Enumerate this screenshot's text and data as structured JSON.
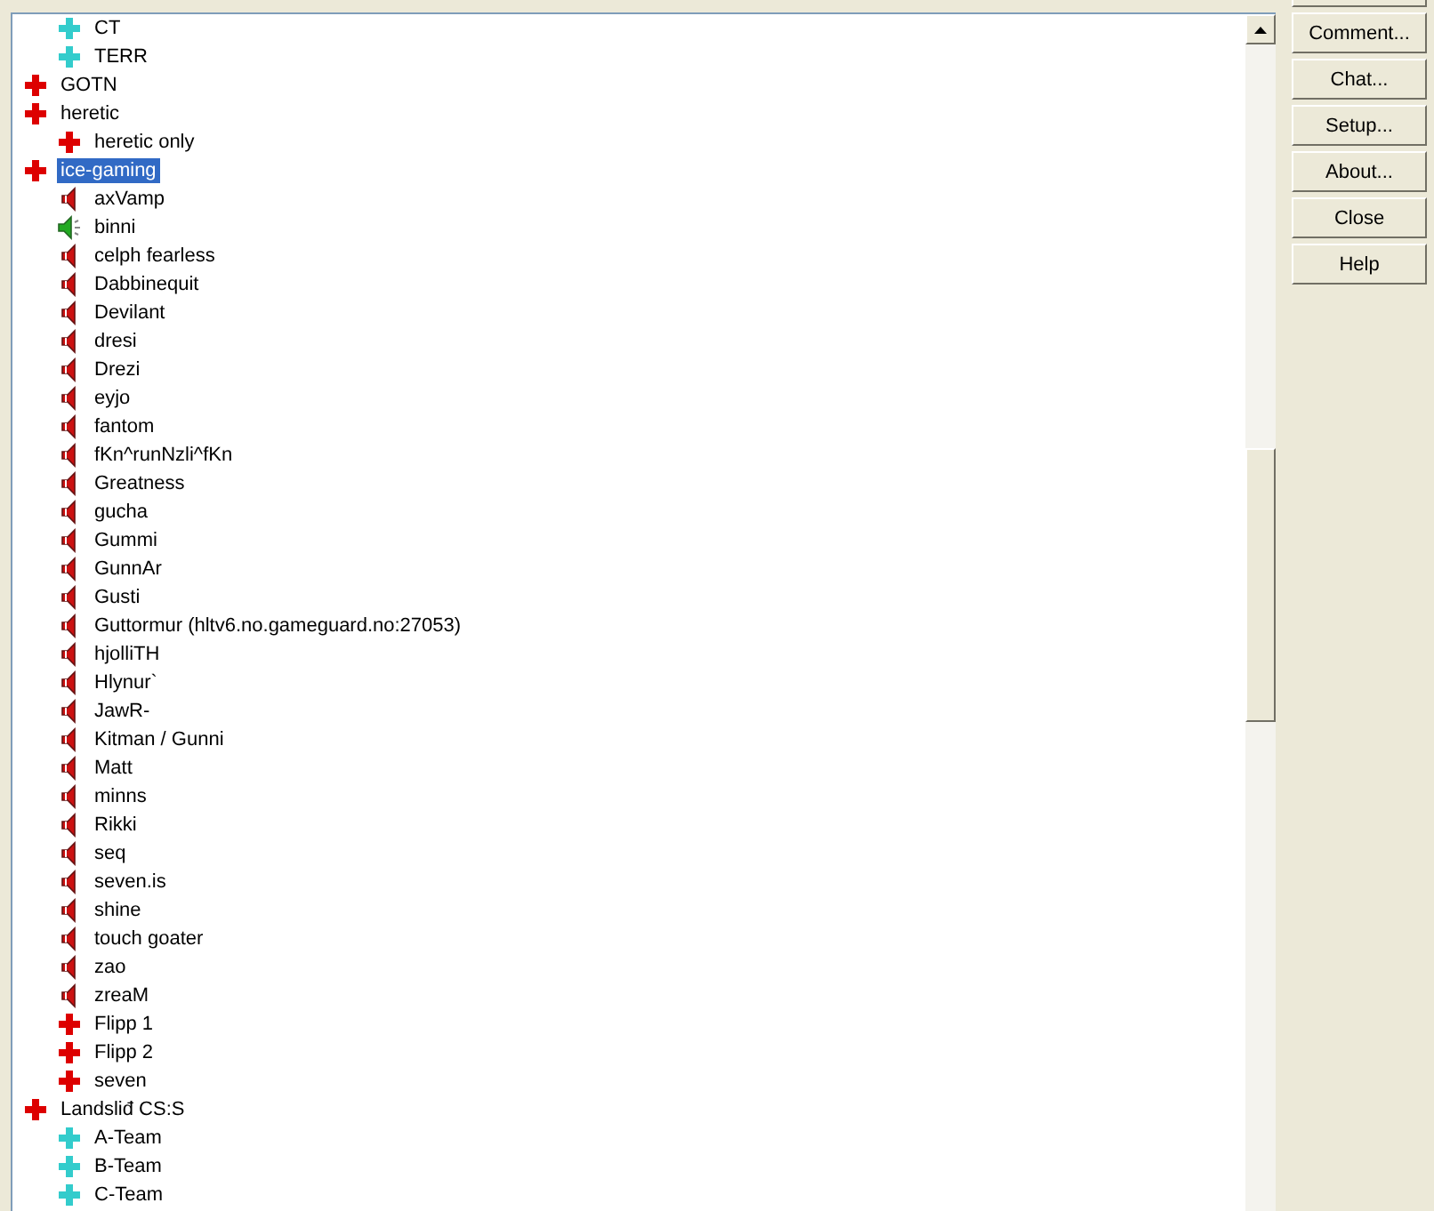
{
  "tree": {
    "continued_children": [
      {
        "kind": "channel",
        "label": "CT",
        "color": "#33cccc",
        "selected": false
      },
      {
        "kind": "channel",
        "label": "TERR",
        "color": "#33cccc",
        "selected": false
      }
    ],
    "items": [
      {
        "kind": "channel",
        "label": "GOTN",
        "color": "#dd0000",
        "selected": false
      },
      {
        "kind": "channel",
        "label": "heretic",
        "color": "#dd0000",
        "selected": false,
        "children": [
          {
            "kind": "channel",
            "label": "heretic only",
            "color": "#dd0000",
            "selected": false
          }
        ]
      },
      {
        "kind": "channel",
        "label": "ice-gaming",
        "color": "#dd0000",
        "selected": true,
        "children": [
          {
            "kind": "player",
            "label": "axVamp",
            "talking": false,
            "selected": false
          },
          {
            "kind": "player",
            "label": "binni",
            "talking": true,
            "selected": false
          },
          {
            "kind": "player",
            "label": "celph fearless",
            "talking": false,
            "selected": false
          },
          {
            "kind": "player",
            "label": "Dabbinequit",
            "talking": false,
            "selected": false
          },
          {
            "kind": "player",
            "label": "Devilant",
            "talking": false,
            "selected": false
          },
          {
            "kind": "player",
            "label": "dresi",
            "talking": false,
            "selected": false
          },
          {
            "kind": "player",
            "label": "Drezi",
            "talking": false,
            "selected": false
          },
          {
            "kind": "player",
            "label": "eyjo",
            "talking": false,
            "selected": false
          },
          {
            "kind": "player",
            "label": "fantom",
            "talking": false,
            "selected": false
          },
          {
            "kind": "player",
            "label": "fKn^runNzli^fKn",
            "talking": false,
            "selected": false
          },
          {
            "kind": "player",
            "label": "Greatness",
            "talking": false,
            "selected": false
          },
          {
            "kind": "player",
            "label": "gucha",
            "talking": false,
            "selected": false
          },
          {
            "kind": "player",
            "label": "Gummi",
            "talking": false,
            "selected": false
          },
          {
            "kind": "player",
            "label": "GunnAr",
            "talking": false,
            "selected": false
          },
          {
            "kind": "player",
            "label": "Gusti",
            "talking": false,
            "selected": false
          },
          {
            "kind": "player",
            "label": "Guttormur (hltv6.no.gameguard.no:27053)",
            "talking": false,
            "selected": false
          },
          {
            "kind": "player",
            "label": "hjolliTH",
            "talking": false,
            "selected": false
          },
          {
            "kind": "player",
            "label": "Hlynur`",
            "talking": false,
            "selected": false
          },
          {
            "kind": "player",
            "label": "JawR-",
            "talking": false,
            "selected": false
          },
          {
            "kind": "player",
            "label": "Kitman / Gunni",
            "talking": false,
            "selected": false
          },
          {
            "kind": "player",
            "label": "Matt",
            "talking": false,
            "selected": false
          },
          {
            "kind": "player",
            "label": "minns",
            "talking": false,
            "selected": false
          },
          {
            "kind": "player",
            "label": "Rikki",
            "talking": false,
            "selected": false
          },
          {
            "kind": "player",
            "label": "seq",
            "talking": false,
            "selected": false
          },
          {
            "kind": "player",
            "label": "seven.is",
            "talking": false,
            "selected": false
          },
          {
            "kind": "player",
            "label": "shine",
            "talking": false,
            "selected": false
          },
          {
            "kind": "player",
            "label": "touch goater",
            "talking": false,
            "selected": false
          },
          {
            "kind": "player",
            "label": "zao",
            "talking": false,
            "selected": false
          },
          {
            "kind": "player",
            "label": "zreaM",
            "talking": false,
            "selected": false
          },
          {
            "kind": "channel",
            "label": "Flipp 1",
            "color": "#dd0000",
            "selected": false
          },
          {
            "kind": "channel",
            "label": "Flipp 2",
            "color": "#dd0000",
            "selected": false
          },
          {
            "kind": "channel",
            "label": "seven",
            "color": "#dd0000",
            "selected": false
          }
        ]
      },
      {
        "kind": "channel",
        "label": "Landsliđ CS:S",
        "color": "#dd0000",
        "selected": false,
        "children": [
          {
            "kind": "channel",
            "label": "A-Team",
            "color": "#33cccc",
            "selected": false
          },
          {
            "kind": "channel",
            "label": "B-Team",
            "color": "#33cccc",
            "selected": false
          },
          {
            "kind": "channel",
            "label": "C-Team",
            "color": "#33cccc",
            "selected": false
          }
        ]
      }
    ]
  },
  "buttons": [
    "Comment...",
    "Chat...",
    "Setup...",
    "About...",
    "Close",
    "Help"
  ]
}
